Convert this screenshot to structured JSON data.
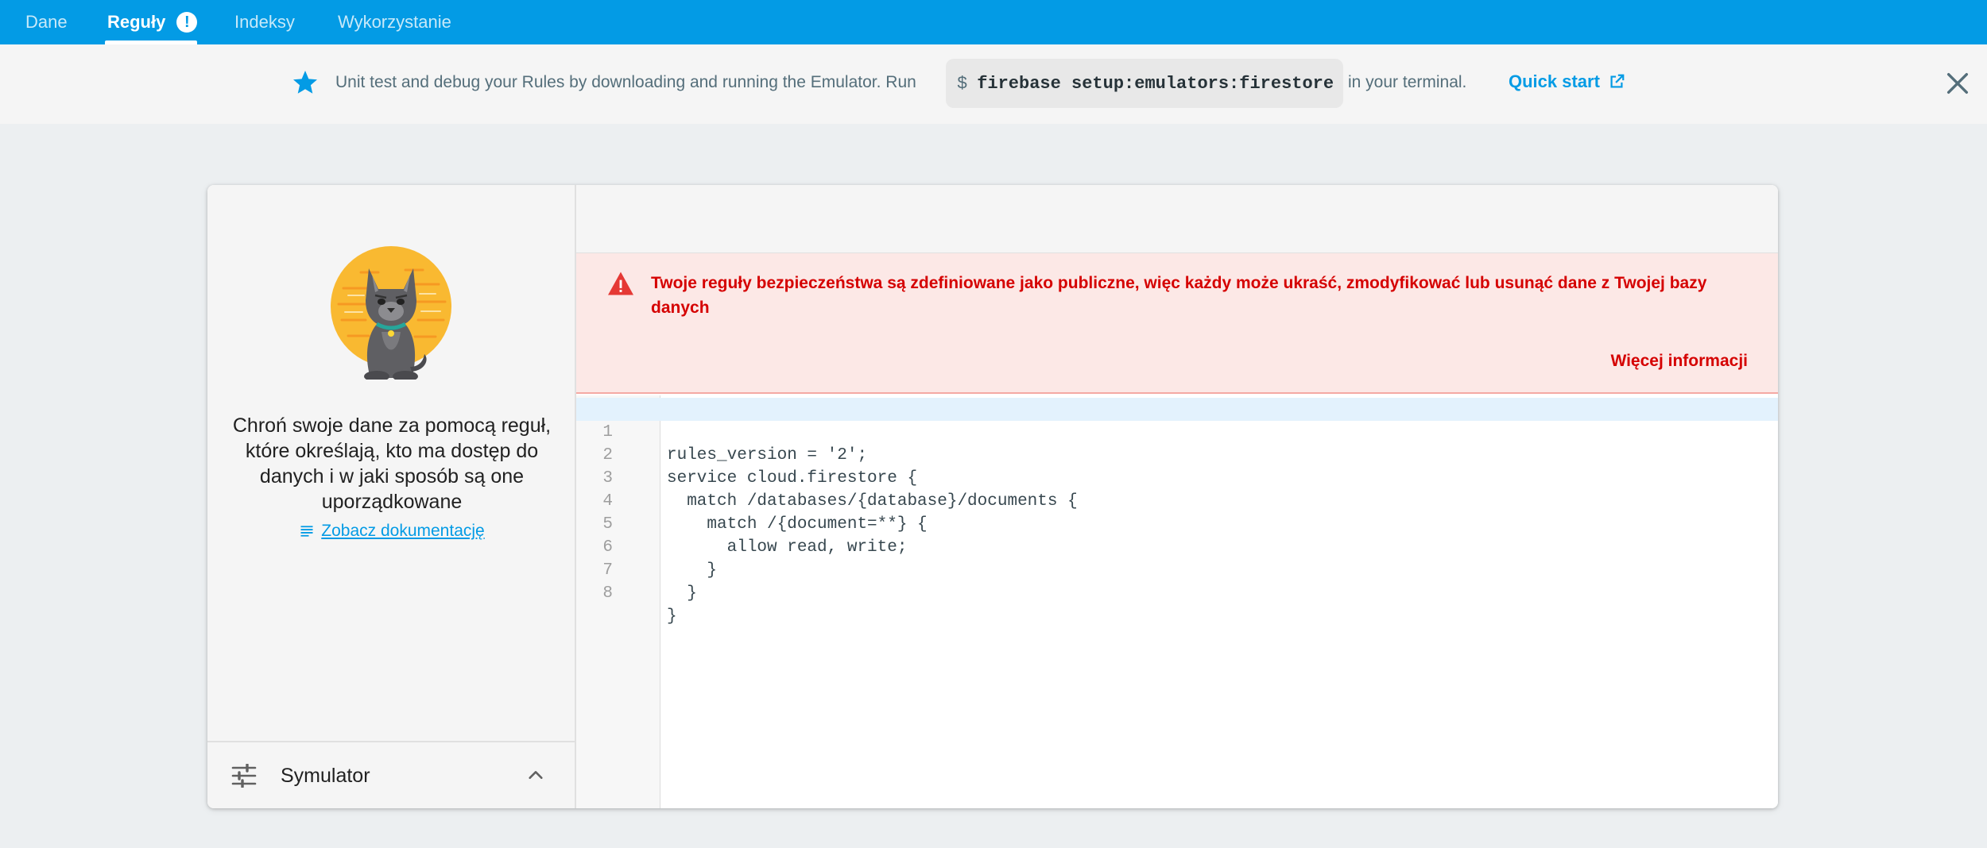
{
  "tabs": [
    {
      "label": "Dane"
    },
    {
      "label": "Reguły",
      "badge": "!"
    },
    {
      "label": "Indeksy"
    },
    {
      "label": "Wykorzystanie"
    }
  ],
  "banner": {
    "text_before": "Unit test and debug your Rules by downloading and running the Emulator. Run",
    "dollar": "$",
    "command": "firebase setup:emulators:firestore",
    "text_after": "in your terminal.",
    "quick_start": "Quick start",
    "icons": {
      "lead": "star-icon",
      "link": "open-in-new-icon",
      "close": "close-icon"
    }
  },
  "left_panel": {
    "description": "Chroń swoje dane za pomocą reguł, które określają, kto ma dostęp do danych i w jaki sposób są one uporządkowane",
    "docs_link": "Zobacz dokumentację",
    "simulator_label": "Symulator",
    "mascot": "cat-mascot-illustration"
  },
  "warning": {
    "text": "Twoje reguły bezpieczeństwa są zdefiniowane jako publiczne, więc każdy może ukraść, zmodyfikować lub usunąć dane z Twojej bazy danych",
    "more": "Więcej informacji"
  },
  "editor": {
    "lines": [
      {
        "n": "1",
        "code": "rules_version = '2';"
      },
      {
        "n": "2",
        "code": "service cloud.firestore {"
      },
      {
        "n": "3",
        "code": "  match /databases/{database}/documents {"
      },
      {
        "n": "4",
        "code": "    match /{document=**} {"
      },
      {
        "n": "5",
        "code": "      allow read, write;"
      },
      {
        "n": "6",
        "code": "    }"
      },
      {
        "n": "7",
        "code": "  }"
      },
      {
        "n": "8",
        "code": "}"
      }
    ]
  },
  "colors": {
    "accent": "#039be5",
    "warning_text": "#d50000",
    "warning_bg": "#fce8e6"
  }
}
